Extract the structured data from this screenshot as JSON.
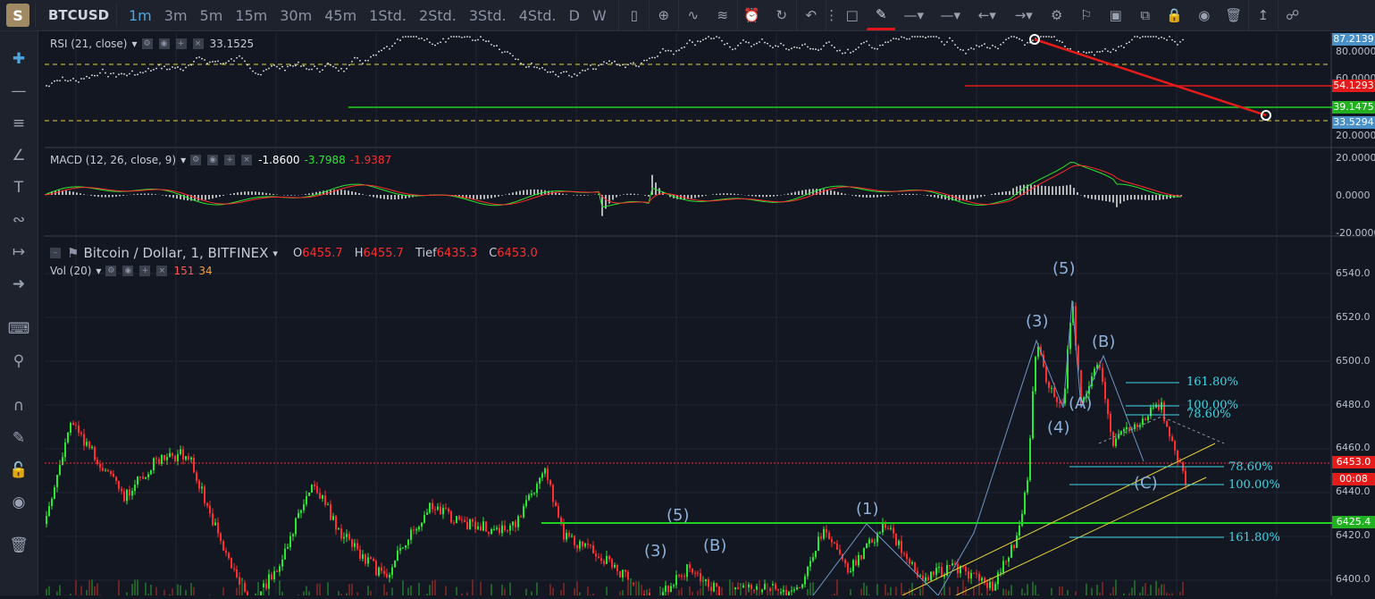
{
  "app": {
    "logo_letter": "S",
    "symbol": "BTCUSD"
  },
  "intervals": [
    {
      "label": "1m",
      "active": true
    },
    {
      "label": "3m"
    },
    {
      "label": "5m"
    },
    {
      "label": "15m"
    },
    {
      "label": "30m"
    },
    {
      "label": "45m"
    },
    {
      "label": "1Std."
    },
    {
      "label": "2Std."
    },
    {
      "label": "3Std."
    },
    {
      "label": "4Std."
    },
    {
      "label": "D"
    },
    {
      "label": "W"
    }
  ],
  "colors": {
    "bg": "#131722",
    "up": "#29e82f",
    "down": "#ff2d2d",
    "accent": "#4ea4dc",
    "fib": "#3fd7e6",
    "wave": "#8fb0d8"
  },
  "rsi": {
    "legend": "RSI (21, close)",
    "value": "33.1525",
    "axis": [
      "80.0000",
      "60.0000",
      "20.0000"
    ],
    "badges": [
      {
        "text": "87.2139",
        "color": "#4a90c8"
      },
      {
        "text": "54.1293",
        "color": "#e41b1b"
      },
      {
        "text": "39.1475",
        "color": "#20b020"
      },
      {
        "text": "33.5294",
        "color": "#4a90c8"
      }
    ]
  },
  "macd": {
    "legend": "MACD (12, 26, close, 9)",
    "v1": "-1.8600",
    "v2": "-3.7988",
    "v3": "-1.9387",
    "axis": [
      "20.0000",
      "0.0000",
      "-20.0000"
    ]
  },
  "main": {
    "title": "Bitcoin / Dollar, 1, BITFINEX",
    "o_label": "O",
    "o": "6455.7",
    "h_label": "H",
    "h": "6455.7",
    "l_label": "Tief",
    "l": "6435.3",
    "c_label": "C",
    "c": "6453.0",
    "vol_legend": "Vol (20)",
    "vol1": "151",
    "vol2": "34",
    "axis": [
      "6540.0",
      "6520.0",
      "6500.0",
      "6480.0",
      "6460.0",
      "6440.0",
      "6420.0",
      "6400.0"
    ],
    "price_badge": "6453.0",
    "timer_badge": "00:08",
    "level_badge": "6425.4"
  },
  "waves": [
    "(5)",
    "(3)",
    "(B)",
    "(4)",
    "(A)",
    "(B)",
    "(C)",
    "(1)",
    "(5)",
    "(3)",
    "(B)"
  ],
  "fibs": [
    "161.80%",
    "100.00%",
    "78.60%",
    "78.60%",
    "100.00%",
    "161.80%"
  ]
}
